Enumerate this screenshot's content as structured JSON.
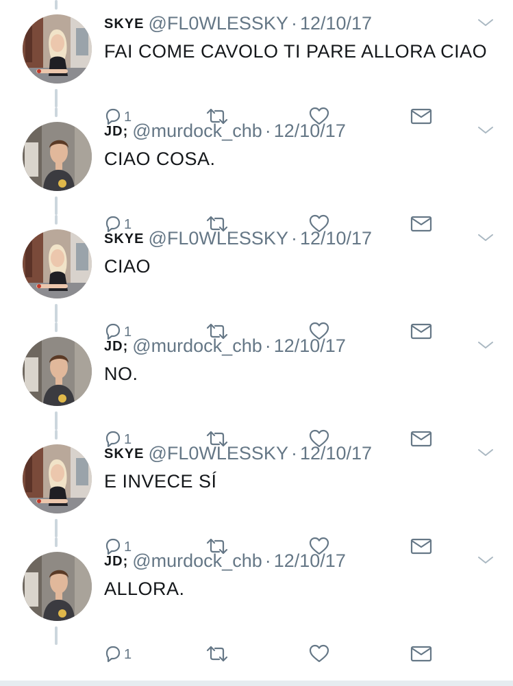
{
  "colors": {
    "text_primary": "#14171a",
    "text_secondary": "#657786",
    "thread_line": "#ccd6dd",
    "icon_gray": "#657786"
  },
  "tweets": [
    {
      "name": "SKYE",
      "handle": "@FL0WLESSKY",
      "separator": "·",
      "date": "12/10/17",
      "text": "FAI COME CAVOLO TI PARE ALLORA CIAO",
      "reply_count": "1",
      "avatar": "blonde-woman-avatar"
    },
    {
      "name": "JD;",
      "handle": "@murdock_chb",
      "separator": "·",
      "date": "12/10/17",
      "text": "CIAO COSA.",
      "reply_count": "1",
      "avatar": "young-man-avatar"
    },
    {
      "name": "SKYE",
      "handle": "@FL0WLESSKY",
      "separator": "·",
      "date": "12/10/17",
      "text": "CIAO",
      "reply_count": "1",
      "avatar": "blonde-woman-avatar"
    },
    {
      "name": "JD;",
      "handle": "@murdock_chb",
      "separator": "·",
      "date": "12/10/17",
      "text": "NO.",
      "reply_count": "1",
      "avatar": "young-man-avatar"
    },
    {
      "name": "SKYE",
      "handle": "@FL0WLESSKY",
      "separator": "·",
      "date": "12/10/17",
      "text": "E INVECE SÍ",
      "reply_count": "1",
      "avatar": "blonde-woman-avatar"
    },
    {
      "name": "JD;",
      "handle": "@murdock_chb",
      "separator": "·",
      "date": "12/10/17",
      "text": "ALLORA.",
      "reply_count": "1",
      "avatar": "young-man-avatar"
    }
  ]
}
